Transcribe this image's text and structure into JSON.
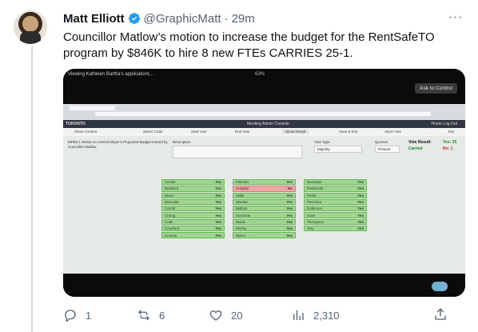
{
  "tweet": {
    "author_name": "Matt Elliott",
    "handle": "@GraphicMatt",
    "separator": "·",
    "time": "29m",
    "text": "Councillor Matlow’s motion to increase the budget for the RentSafeTO program by $846K to hire 8 new FTEs CARRIES 25-1.",
    "more_label": "···"
  },
  "media": {
    "screen_title": "Viewing Kathleen Bartha's application(...",
    "zoom": "63%",
    "ask_control": "Ask to Control",
    "app": {
      "logo": "TORONTO",
      "title": "Meeting Admin Console",
      "nav": "Home    Log Out",
      "toolbar": [
        "Show Content",
        "Select Chair",
        "Start Vote",
        "End Vote",
        "Show Result",
        "Save & Exit",
        "Abort Vote",
        "Exit"
      ],
      "motion_text": "MPB4.1 Motion to Amend Mayor's Proposed Budget moved by Councillor Matlow",
      "description_label": "Description",
      "vote_type_label": "Vote Type",
      "vote_type_value": "Majority",
      "quorum_label": "Quorum",
      "quorum_value": "Present",
      "vote_result_label": "Vote Result:",
      "vote_result_value": "Carried",
      "yes_tally": "Yes: 25",
      "no_tally": "No: 1",
      "votes": [
        [
          {
            "name": "Ainslie",
            "vote": "Yes"
          },
          {
            "name": "Bradford",
            "vote": "Yes"
          },
          {
            "name": "Bravo",
            "vote": "Yes"
          },
          {
            "name": "Burnside",
            "vote": "Yes"
          },
          {
            "name": "Carroll",
            "vote": "Yes"
          },
          {
            "name": "Cheng",
            "vote": "Yes"
          },
          {
            "name": "Colle",
            "vote": "Yes"
          },
          {
            "name": "Crawford",
            "vote": "Yes"
          },
          {
            "name": "Crisanti",
            "vote": "Yes"
          }
        ],
        [
          {
            "name": "Fletcher",
            "vote": "Yes"
          },
          {
            "name": "Holyday",
            "vote": "No"
          },
          {
            "name": "Malik",
            "vote": "Yes"
          },
          {
            "name": "Mantas",
            "vote": "Yes"
          },
          {
            "name": "Matlow",
            "vote": "Yes"
          },
          {
            "name": "McKelvie",
            "vote": "Yes"
          },
          {
            "name": "Moise",
            "vote": "Yes"
          },
          {
            "name": "Morley",
            "vote": "Yes"
          },
          {
            "name": "Myers",
            "vote": "Yes"
          }
        ],
        [
          {
            "name": "Nunziata",
            "vote": "Yes"
          },
          {
            "name": "Pasternak",
            "vote": "Yes"
          },
          {
            "name": "Perks",
            "vote": "Yes"
          },
          {
            "name": "Perruzza",
            "vote": "Yes"
          },
          {
            "name": "Robinson",
            "vote": "Yes"
          },
          {
            "name": "Saxe",
            "vote": "Yes"
          },
          {
            "name": "Thompson",
            "vote": "Yes"
          },
          {
            "name": "Tory",
            "vote": "Yes"
          }
        ]
      ]
    }
  },
  "actions": {
    "replies": "1",
    "retweets": "6",
    "likes": "20",
    "views": "2,310"
  },
  "colors": {
    "verified": "#1d9bf0",
    "muted": "#536471",
    "yes": "#9ed68f",
    "no": "#f1a6a6"
  }
}
